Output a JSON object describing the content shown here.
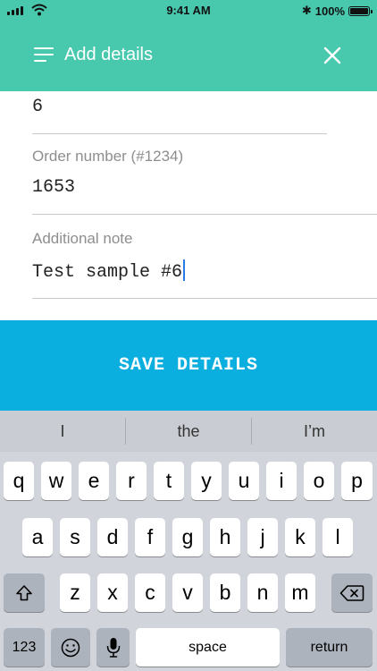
{
  "status_bar": {
    "time": "9:41 AM",
    "battery": "100%",
    "bluetooth_icon": "bluetooth-icon"
  },
  "app_bar": {
    "title": "Add details",
    "menu_icon": "menu-icon",
    "close_icon": "close-icon",
    "color": "#48c9ae"
  },
  "form": {
    "prev_field": {
      "value": "6"
    },
    "order_number": {
      "label": "Order number (#1234)",
      "value": "1653"
    },
    "additional_note": {
      "label": "Additional note",
      "value": "Test sample #6"
    }
  },
  "save_button": {
    "label": "SAVE DETAILS",
    "color": "#0aafe0"
  },
  "keyboard": {
    "suggestions": [
      "I",
      "the",
      "I’m"
    ],
    "row1": [
      "q",
      "w",
      "e",
      "r",
      "t",
      "y",
      "u",
      "i",
      "o",
      "p"
    ],
    "row2": [
      "a",
      "s",
      "d",
      "f",
      "g",
      "h",
      "j",
      "k",
      "l"
    ],
    "row3": [
      "z",
      "x",
      "c",
      "v",
      "b",
      "n",
      "m"
    ],
    "numbers_label": "123",
    "space_label": "space",
    "return_label": "return",
    "shift_icon": "shift-icon",
    "delete_icon": "delete-icon",
    "emoji_icon": "emoji-icon",
    "mic_icon": "microphone-icon"
  }
}
